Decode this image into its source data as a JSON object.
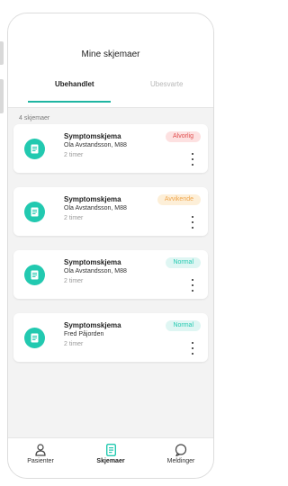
{
  "header": {
    "title": "Mine skjemaer",
    "tabs": [
      {
        "label": "Ubehandlet",
        "active": true
      },
      {
        "label": "Ubesvarte",
        "active": false
      }
    ]
  },
  "list": {
    "count_label": "4 skjemaer",
    "items": [
      {
        "title": "Symptomskjema",
        "patient": "Ola Avstandsson, M88",
        "time": "2 timer",
        "status": "Alvorlig",
        "status_color": "#e04d4d"
      },
      {
        "title": "Symptomskjema",
        "patient": "Ola Avstandsson, M88",
        "time": "2 timer",
        "status": "Avvikende",
        "status_color": "#f0a54c"
      },
      {
        "title": "Symptomskjema",
        "patient": "Ola Avstandsson, M88",
        "time": "2 timer",
        "status": "Normal",
        "status_color": "#22c9b0"
      },
      {
        "title": "Symptomskjema",
        "patient": "Fred Påjorden",
        "time": "2 timer",
        "status": "Normal",
        "status_color": "#22c9b0"
      }
    ]
  },
  "bottom_nav": {
    "items": [
      {
        "label": "Pasienter",
        "icon": "person-icon",
        "active": false
      },
      {
        "label": "Skjemaer",
        "icon": "document-icon",
        "active": true
      },
      {
        "label": "Meldinger",
        "icon": "chat-bubble-icon",
        "active": false
      }
    ]
  },
  "colors": {
    "accent": "#22c9b0"
  }
}
